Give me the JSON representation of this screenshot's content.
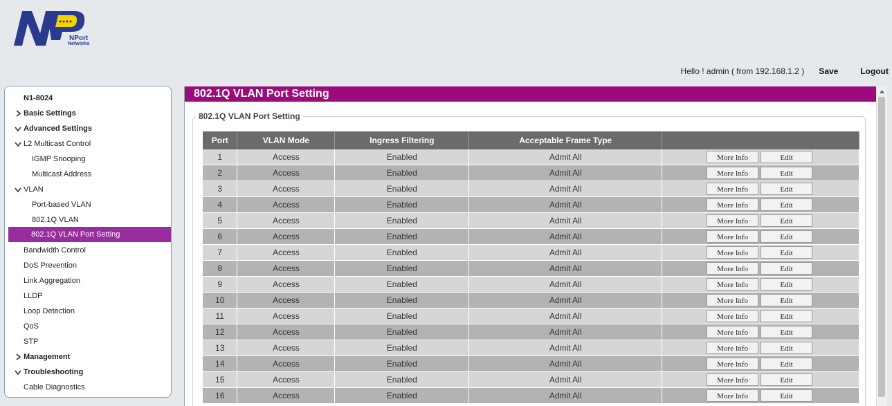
{
  "brand": {
    "logo_line1": "NPort",
    "logo_line2": "Networks",
    "colors": {
      "navy": "#2a3a8f",
      "yellow": "#f4d400"
    }
  },
  "topbar": {
    "greeting": "Hello ! admin ( from 192.168.1.2 )",
    "save": "Save",
    "logout": "Logout"
  },
  "sidebar": {
    "items": [
      {
        "label": "N1-8024",
        "bold": true,
        "chevron": "",
        "indent": 1
      },
      {
        "label": "Basic Settings",
        "bold": true,
        "chevron": "chevron-right-icon",
        "indent": 1
      },
      {
        "label": "Advanced Settings",
        "bold": true,
        "chevron": "chevron-down-icon",
        "indent": 1
      },
      {
        "label": "L2 Multicast Control",
        "bold": false,
        "chevron": "chevron-down-icon",
        "indent": 1
      },
      {
        "label": "IGMP Snooping",
        "bold": false,
        "chevron": "",
        "indent": 2
      },
      {
        "label": "Multicast Address",
        "bold": false,
        "chevron": "",
        "indent": 2
      },
      {
        "label": "VLAN",
        "bold": false,
        "chevron": "chevron-down-icon",
        "indent": 1
      },
      {
        "label": "Port-based VLAN",
        "bold": false,
        "chevron": "",
        "indent": 2
      },
      {
        "label": "802.1Q VLAN",
        "bold": false,
        "chevron": "",
        "indent": 2
      },
      {
        "label": "802.1Q VLAN Port Setting",
        "bold": false,
        "chevron": "",
        "indent": 2,
        "active": true
      },
      {
        "label": "Bandwidth Control",
        "bold": false,
        "chevron": "",
        "indent": 1
      },
      {
        "label": "DoS Prevention",
        "bold": false,
        "chevron": "",
        "indent": 1
      },
      {
        "label": "Link Aggregation",
        "bold": false,
        "chevron": "",
        "indent": 1
      },
      {
        "label": "LLDP",
        "bold": false,
        "chevron": "",
        "indent": 1
      },
      {
        "label": "Loop Detection",
        "bold": false,
        "chevron": "",
        "indent": 1
      },
      {
        "label": "QoS",
        "bold": false,
        "chevron": "",
        "indent": 1
      },
      {
        "label": "STP",
        "bold": false,
        "chevron": "",
        "indent": 1
      },
      {
        "label": "Management",
        "bold": true,
        "chevron": "chevron-right-icon",
        "indent": 1
      },
      {
        "label": "Troubleshooting",
        "bold": true,
        "chevron": "chevron-down-icon",
        "indent": 1
      },
      {
        "label": "Cable Diagnostics",
        "bold": false,
        "chevron": "",
        "indent": 1
      }
    ],
    "active_color": "#9a2d9e"
  },
  "main": {
    "title": "802.1Q VLAN Port Setting",
    "title_color": "#9c0b7c",
    "section_legend": "802.1Q VLAN Port Setting",
    "table": {
      "headers": [
        "Port",
        "VLAN Mode",
        "Ingress Filtering",
        "Acceptable Frame Type",
        ""
      ],
      "more_info_label": "More Info",
      "edit_label": "Edit",
      "rows": [
        {
          "port": "1",
          "mode": "Access",
          "ingress": "Enabled",
          "frame": "Admit All"
        },
        {
          "port": "2",
          "mode": "Access",
          "ingress": "Enabled",
          "frame": "Admit All"
        },
        {
          "port": "3",
          "mode": "Access",
          "ingress": "Enabled",
          "frame": "Admit All"
        },
        {
          "port": "4",
          "mode": "Access",
          "ingress": "Enabled",
          "frame": "Admit All"
        },
        {
          "port": "5",
          "mode": "Access",
          "ingress": "Enabled",
          "frame": "Admit All"
        },
        {
          "port": "6",
          "mode": "Access",
          "ingress": "Enabled",
          "frame": "Admit All"
        },
        {
          "port": "7",
          "mode": "Access",
          "ingress": "Enabled",
          "frame": "Admit All"
        },
        {
          "port": "8",
          "mode": "Access",
          "ingress": "Enabled",
          "frame": "Admit All"
        },
        {
          "port": "9",
          "mode": "Access",
          "ingress": "Enabled",
          "frame": "Admit All"
        },
        {
          "port": "10",
          "mode": "Access",
          "ingress": "Enabled",
          "frame": "Admit All"
        },
        {
          "port": "11",
          "mode": "Access",
          "ingress": "Enabled",
          "frame": "Admit All"
        },
        {
          "port": "12",
          "mode": "Access",
          "ingress": "Enabled",
          "frame": "Admit All"
        },
        {
          "port": "13",
          "mode": "Access",
          "ingress": "Enabled",
          "frame": "Admit All"
        },
        {
          "port": "14",
          "mode": "Access",
          "ingress": "Enabled",
          "frame": "Admit All"
        },
        {
          "port": "15",
          "mode": "Access",
          "ingress": "Enabled",
          "frame": "Admit All"
        },
        {
          "port": "16",
          "mode": "Access",
          "ingress": "Enabled",
          "frame": "Admit All"
        }
      ]
    }
  }
}
